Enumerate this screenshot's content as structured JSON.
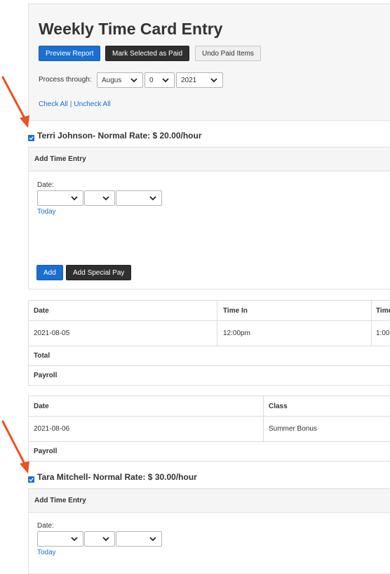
{
  "page": {
    "title": "Weekly Time Card Entry",
    "toolbar": {
      "preview_label": "Preview Report",
      "mark_paid_label": "Mark Selected as Paid",
      "undo_paid_label": "Undo Paid Items"
    },
    "process_through": {
      "label": "Process through:",
      "month": "Augus",
      "day": "0",
      "year": "2021"
    },
    "check_all": "Check All",
    "separator": "|",
    "uncheck_all": "Uncheck All"
  },
  "employees": [
    {
      "name": "Terri Johnson- Normal Rate: $ 20.00/hour",
      "add_time_entry": {
        "heading": "Add Time Entry",
        "date_label": "Date:",
        "today_link": "Today",
        "add_label": "Add",
        "special_pay_label": "Add Special Pay"
      },
      "time_table": {
        "columns": [
          "Date",
          "Time In",
          "Time"
        ],
        "rows": [
          [
            "2021-08-05",
            "12:00pm",
            "1:00"
          ]
        ],
        "total_label": "Total",
        "payroll_label": "Payroll"
      },
      "special_table": {
        "columns": [
          "Date",
          "Class"
        ],
        "rows": [
          [
            "2021-08-06",
            "Summer Bonus"
          ]
        ],
        "payroll_label": "Payroll"
      }
    },
    {
      "name": "Tara Mitchell- Normal Rate: $ 30.00/hour",
      "add_time_entry": {
        "heading": "Add Time Entry",
        "date_label": "Date:",
        "today_link": "Today"
      }
    }
  ],
  "colors": {
    "accent": "#1a6fcf",
    "dark_button": "#2f2f2f",
    "annotation_arrow": "#f04e23"
  }
}
